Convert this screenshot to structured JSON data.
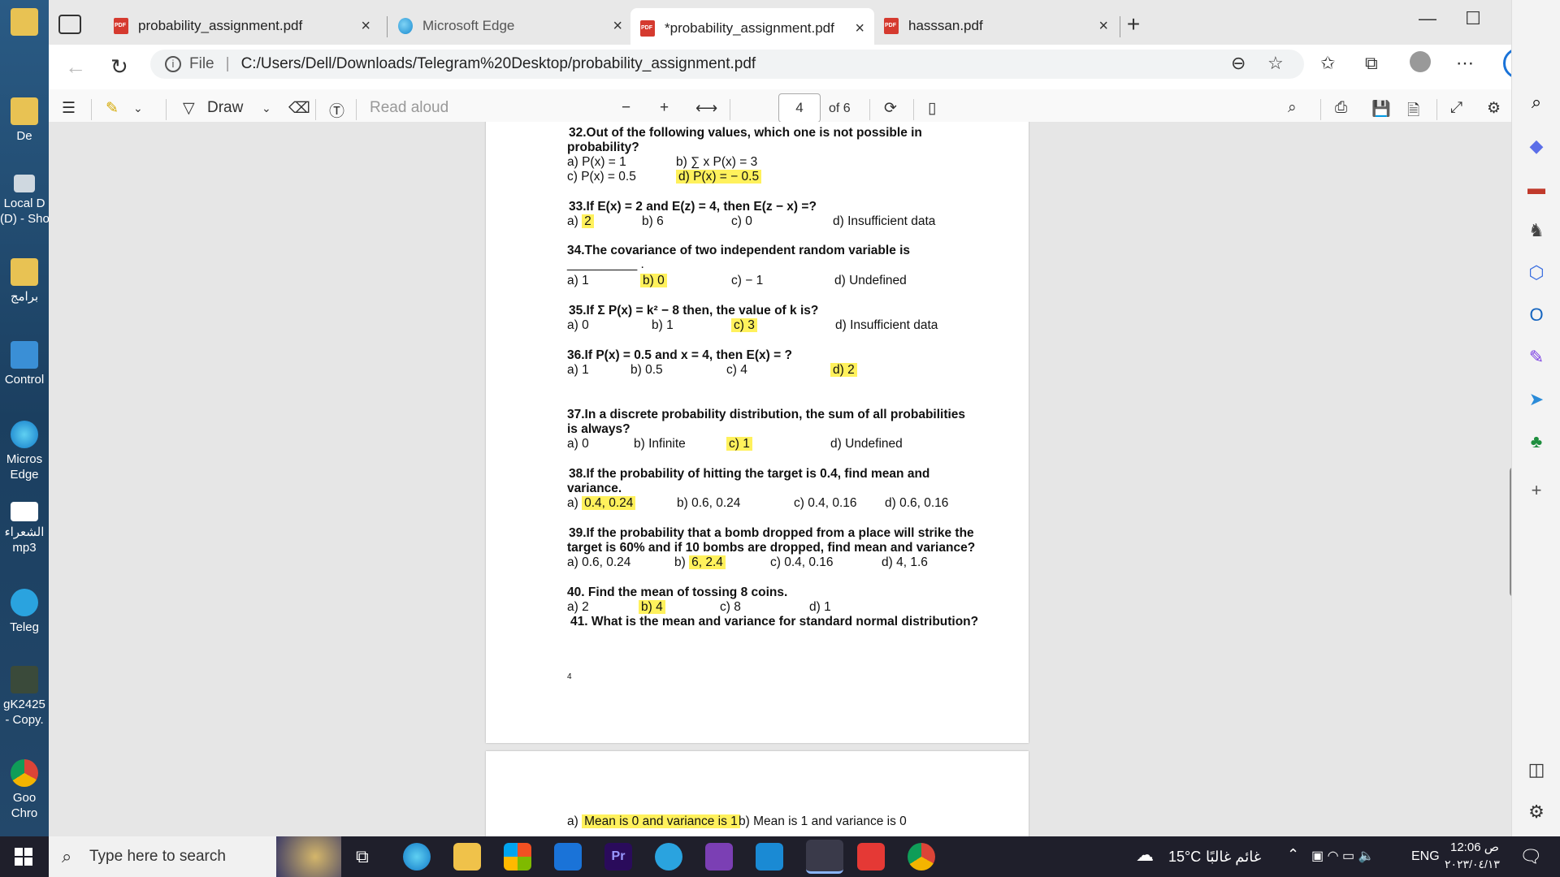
{
  "desktop": {
    "icons": [
      {
        "label": "De"
      },
      {
        "label": "Local D"
      },
      {
        "label": "(D) - Sho"
      },
      {
        "label": "برامج"
      },
      {
        "label": "Control"
      },
      {
        "label": "Micros"
      },
      {
        "label": "Edge"
      },
      {
        "label": "الشعراء"
      },
      {
        "label": "mp3"
      },
      {
        "label": "Teleg"
      },
      {
        "label": "gK2425"
      },
      {
        "label": "- Copy."
      },
      {
        "label": "Goo"
      },
      {
        "label": "Chro"
      }
    ]
  },
  "browser": {
    "tabs": [
      {
        "title": "probability_assignment.pdf",
        "icon": "pdf-icon"
      },
      {
        "title": "Microsoft Edge",
        "icon": "edge-icon"
      },
      {
        "title": "*probability_assignment.pdf",
        "icon": "pdf-icon"
      },
      {
        "title": "hasssan.pdf",
        "icon": "pdf-icon"
      }
    ],
    "url_scheme": "File",
    "url": "C:/Users/Dell/Downloads/Telegram%20Desktop/probability_assignment.pdf"
  },
  "pdf_toolbar": {
    "draw_label": "Draw",
    "read_aloud_label": "Read aloud",
    "current_page": "4",
    "total_pages": "of 6"
  },
  "page4": {
    "page_number": "4",
    "questions": [
      {
        "text_line1": "32.Out of the following values, which one is not possible in",
        "text_line2": "probability?",
        "options": [
          "a) P(x) = 1",
          "b) ∑ x P(x) = 3",
          "c) P(x) = 0.5",
          "d) P(x) = − 0.5"
        ]
      },
      {
        "text_line1": "33.If E(x) = 2 and E(z) = 4, then E(z − x) =?",
        "options": [
          "a) ",
          "2",
          "b) 6",
          "c) 0",
          "d) Insufficient data"
        ]
      },
      {
        "text_line1": "34.The covariance of two independent random variable is",
        "blank": "__________ .",
        "options": [
          "a) 1",
          "b) 0",
          "c) − 1",
          "d) Undefined"
        ]
      },
      {
        "text_line1": "35.If Σ P(x) = k² − 8 then, the value of k is?",
        "options": [
          "a) 0",
          "b) 1",
          "c) 3",
          "d) Insufficient data"
        ]
      },
      {
        "text_line1": "36.If P(x) = 0.5 and x = 4, then E(x) = ?",
        "options": [
          "a) 1",
          "b) 0.5",
          "c) 4",
          "d) 2"
        ]
      },
      {
        "text_line1": "37.In a discrete probability distribution, the sum of all probabilities",
        "text_line2": "is always?",
        "options": [
          "a) 0",
          "b) Infinite",
          "c) 1",
          "d) Undefined"
        ]
      },
      {
        "text_line1": "38.If the probability of hitting the target is 0.4, find mean and",
        "text_line2": "variance.",
        "options": [
          "a) ",
          "0.4, 0.24",
          "b) 0.6, 0.24",
          "c) 0.4, 0.16",
          "d) 0.6, 0.16"
        ]
      },
      {
        "text_line1": "39.If the probability that a bomb dropped from a place will strike the",
        "text_line2": "target is 60% and if 10 bombs are dropped, find mean and variance?",
        "options": [
          "a) 0.6, 0.24",
          "b) ",
          "6, 2.4",
          "c) 0.4, 0.16",
          "d) 4, 1.6"
        ]
      },
      {
        "text_line1": "40. Find the mean of tossing 8 coins.",
        "options": [
          "a) 2",
          "b) 4",
          "c) 8",
          "d) 1"
        ]
      },
      {
        "text_line1": "41. What is the mean and variance for standard normal distribution?"
      }
    ]
  },
  "page5": {
    "options": [
      "a) ",
      "Mean is 0 and variance is 1",
      "b) Mean is 1 and variance is 0"
    ]
  },
  "taskbar": {
    "search_placeholder": "Type here to search",
    "weather": "15°C",
    "weather_desc": "غائم غالبًا",
    "lang": "ENG",
    "time": "12:06 ص",
    "date": "٢٠٢٣/٠٤/١٣"
  }
}
